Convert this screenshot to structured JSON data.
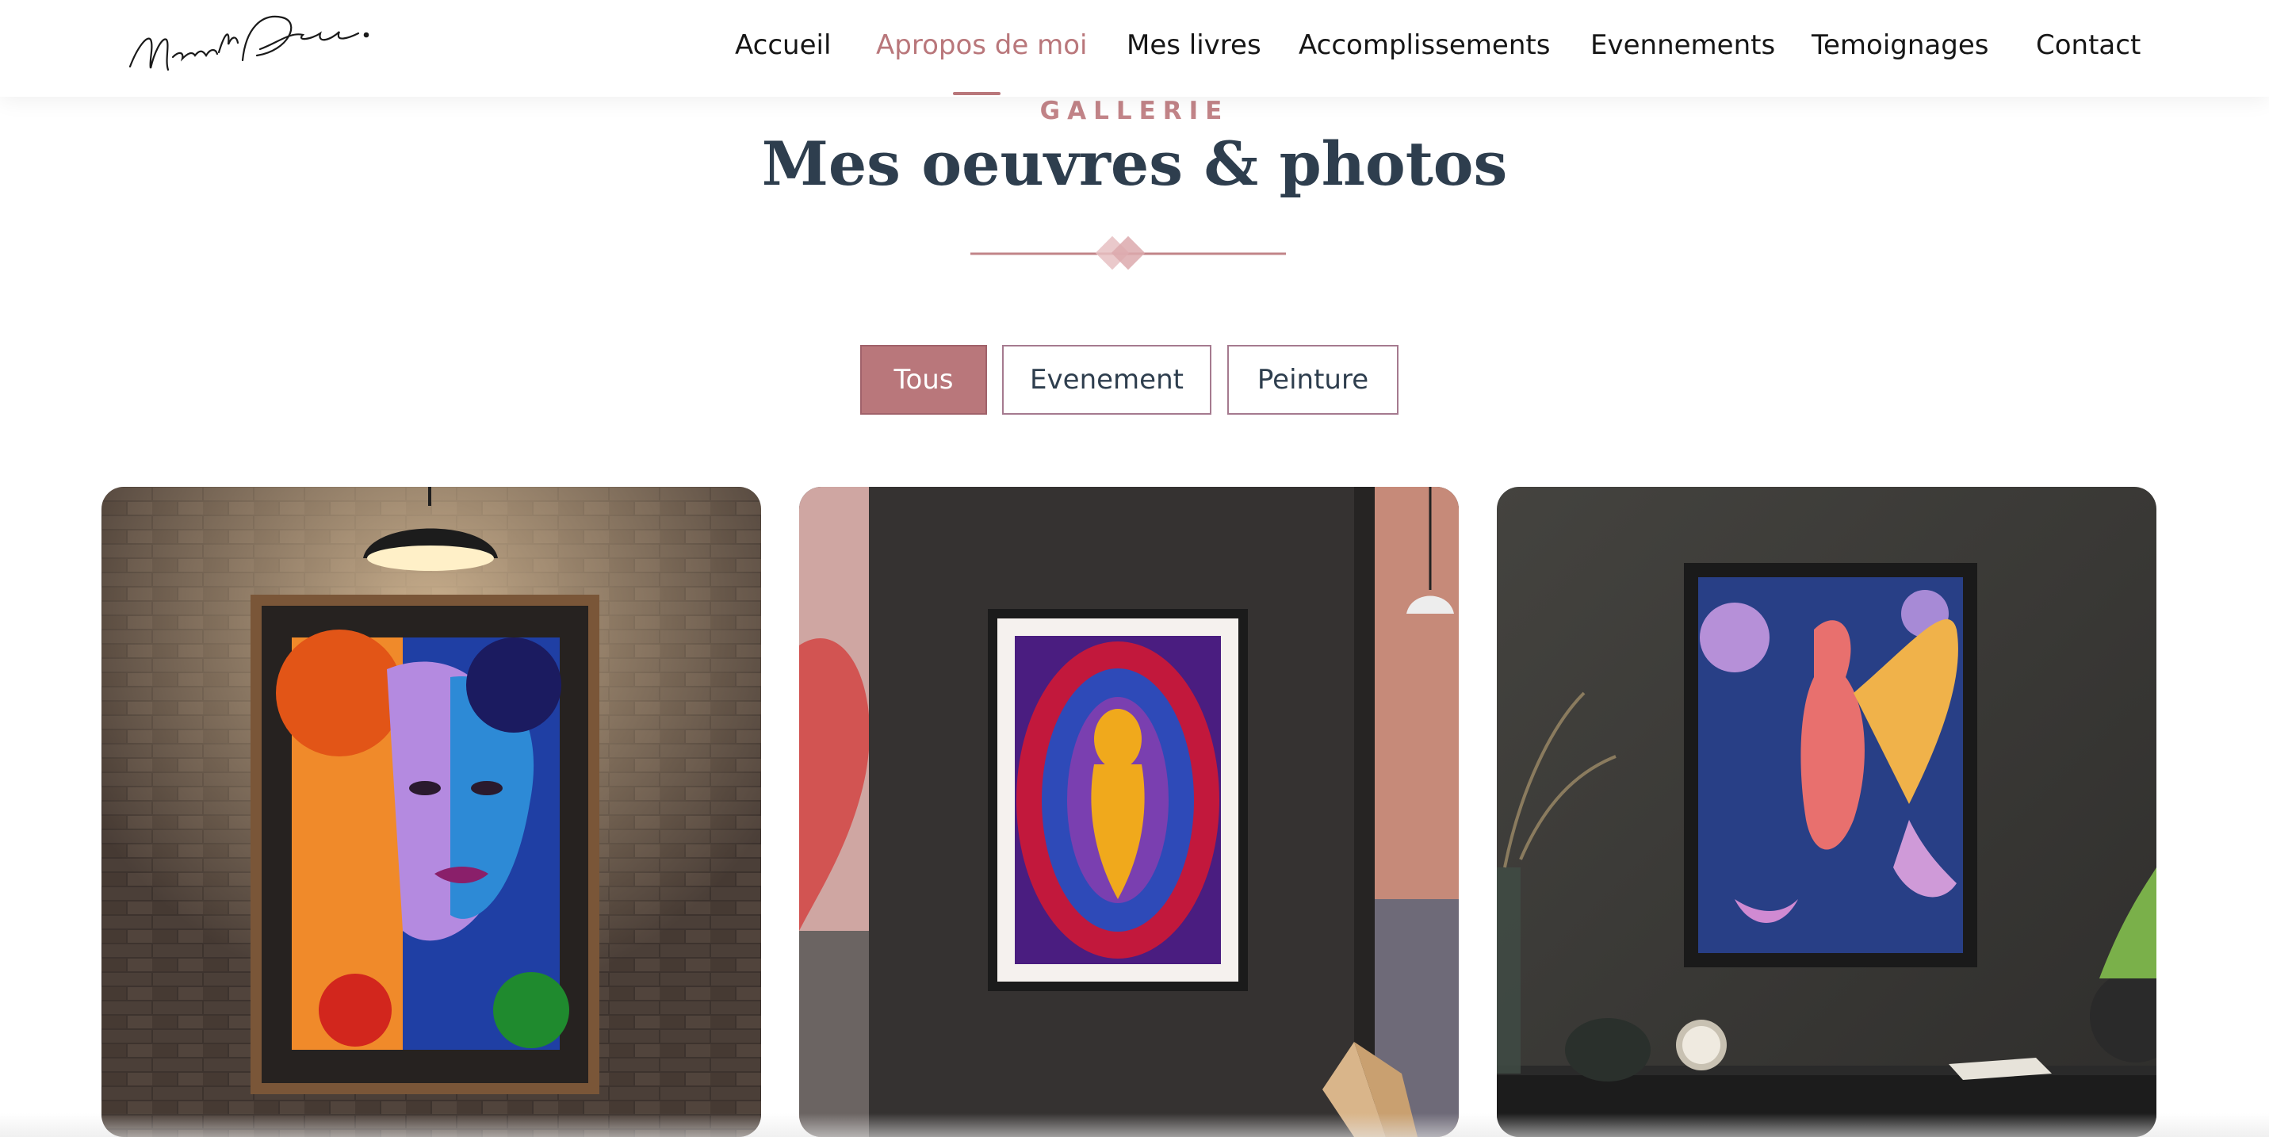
{
  "brand": {
    "logo_text": "Murielle Desgrottes."
  },
  "nav": {
    "items": [
      {
        "label": "Accueil",
        "active": false
      },
      {
        "label": "Apropos de moi",
        "active": true
      },
      {
        "label": "Mes livres",
        "active": false
      },
      {
        "label": "Accomplissements",
        "active": false
      },
      {
        "label": "Evennements",
        "active": false
      },
      {
        "label": "Temoignages",
        "active": false
      },
      {
        "label": "Contact",
        "active": false
      }
    ]
  },
  "section": {
    "eyebrow": "GALLERIE",
    "title": "Mes oeuvres & photos"
  },
  "filters": {
    "items": [
      {
        "label": "Tous",
        "active": true
      },
      {
        "label": "Evenement",
        "active": false
      },
      {
        "label": "Peinture",
        "active": false
      }
    ]
  },
  "gallery": {
    "items": [
      {
        "scene": "framed painting of a woman's face on a brick wall under a lamp",
        "category": "Peinture"
      },
      {
        "scene": "framed abstract painting of a golden figure in a swirl",
        "category": "Peinture"
      },
      {
        "scene": "framed painting of a winged figure on a dark wall",
        "category": "Peinture"
      }
    ]
  },
  "colors": {
    "accent": "#b9777b",
    "heading": "#2e3e4e",
    "nav_text": "#161616"
  }
}
